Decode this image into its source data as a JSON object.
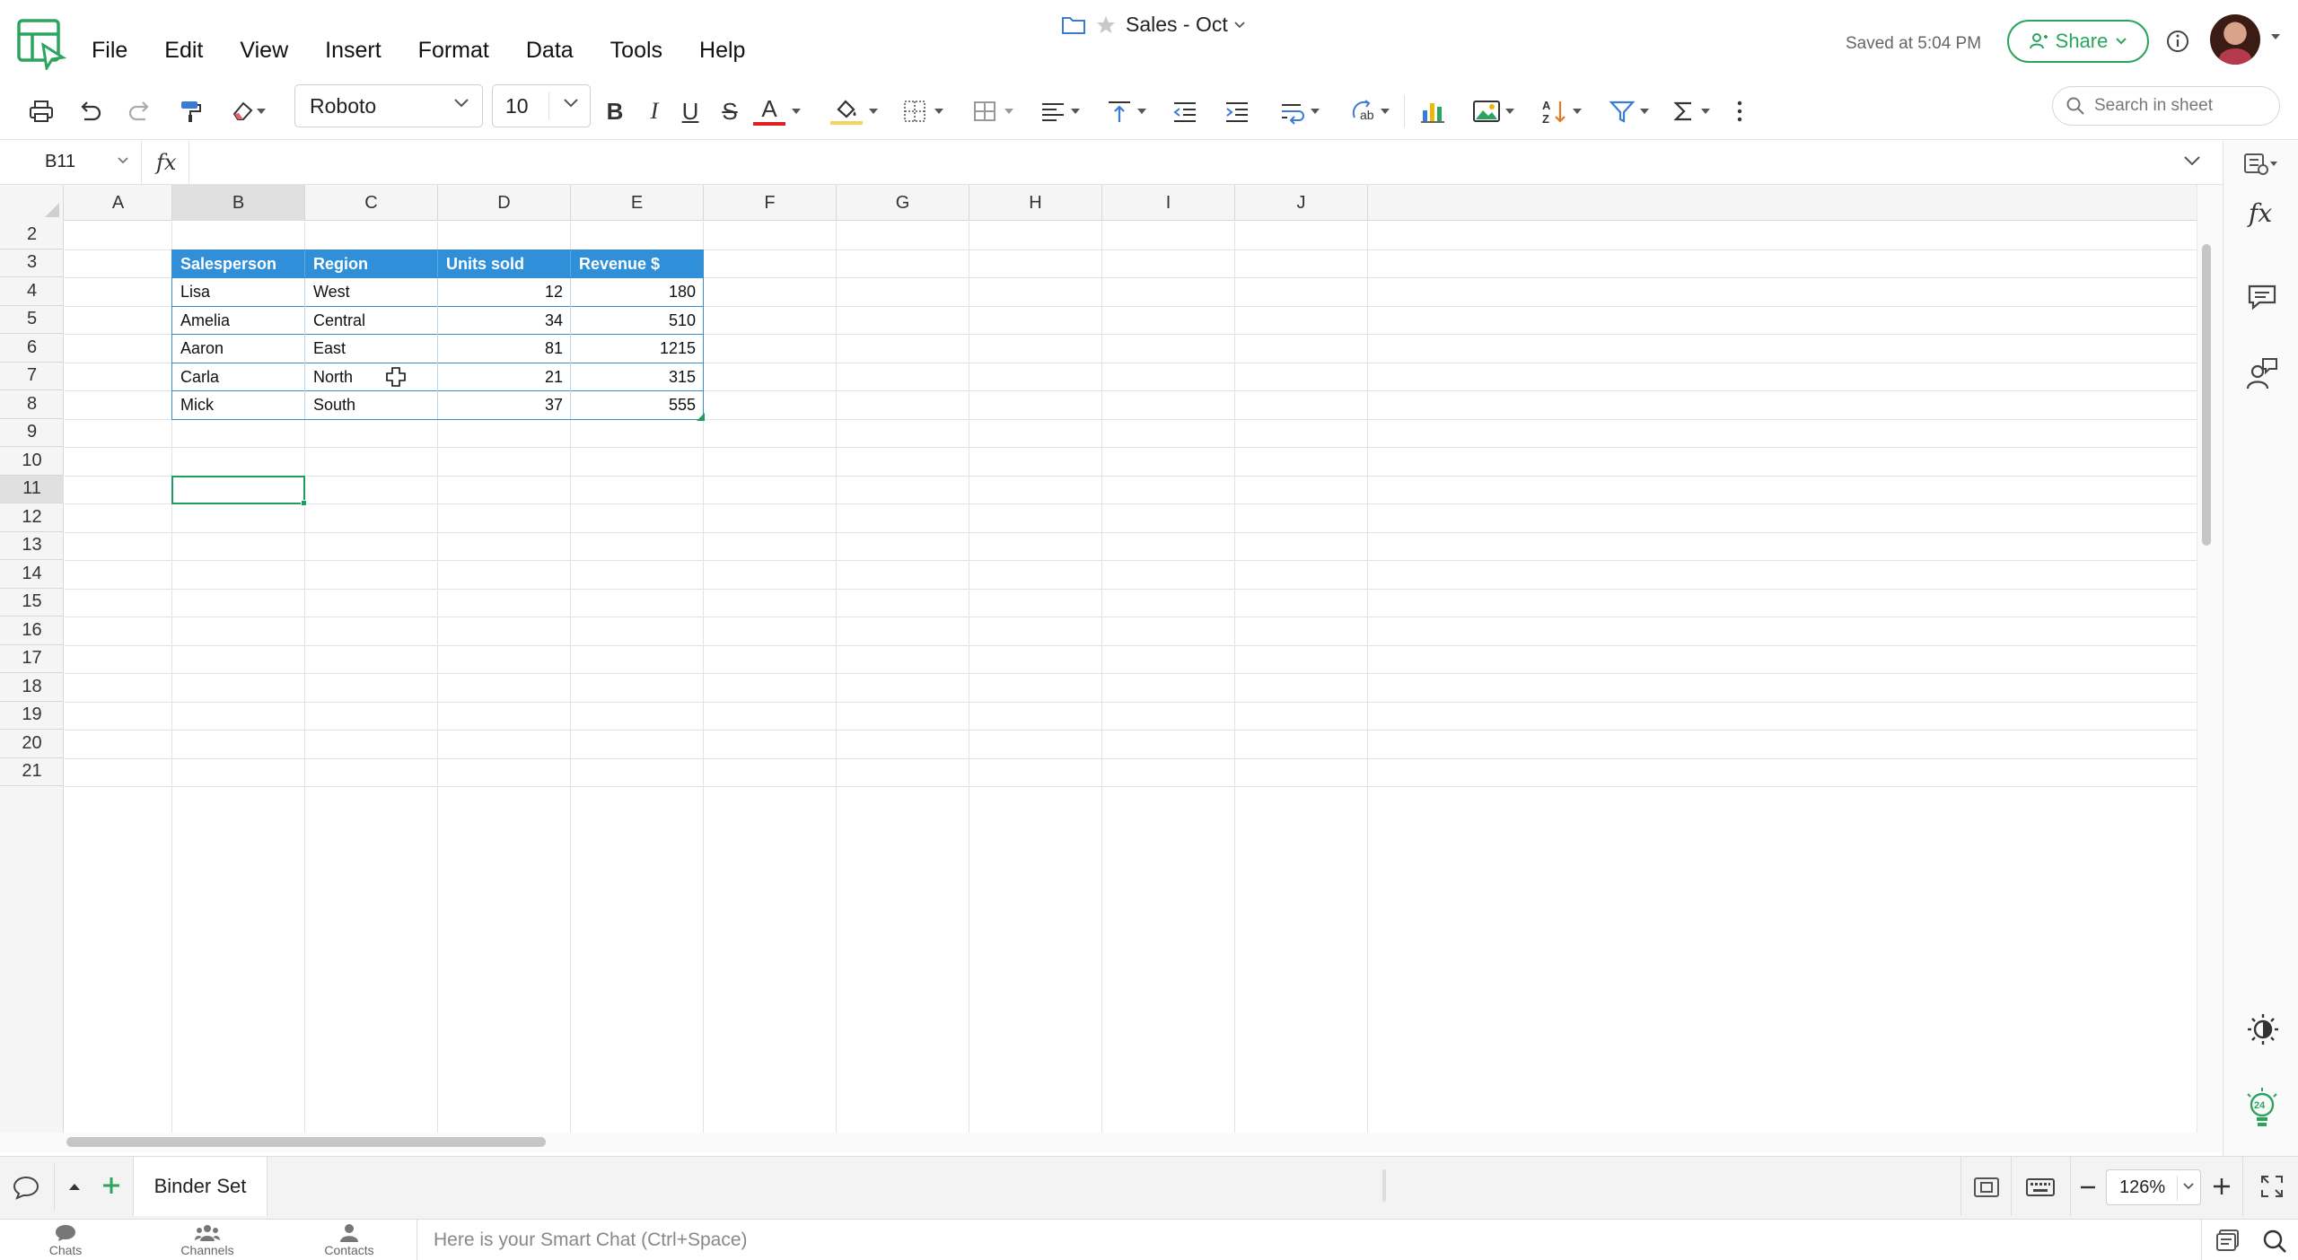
{
  "menu": [
    "File",
    "Edit",
    "View",
    "Insert",
    "Format",
    "Data",
    "Tools",
    "Help"
  ],
  "document": {
    "title": "Sales - Oct",
    "saved_status": "Saved at 5:04 PM"
  },
  "share": {
    "label": "Share"
  },
  "toolbar": {
    "font": "Roboto",
    "font_size": "10",
    "search_placeholder": "Search in sheet"
  },
  "formula_bar": {
    "cell_ref": "B11",
    "fx": "fx",
    "value": ""
  },
  "columns": [
    "A",
    "B",
    "C",
    "D",
    "E",
    "F",
    "G",
    "H",
    "I",
    "J"
  ],
  "selected_column": "B",
  "rows": [
    "2",
    "3",
    "4",
    "5",
    "6",
    "7",
    "8",
    "9",
    "10",
    "11",
    "12",
    "13",
    "14",
    "15",
    "16",
    "17",
    "18",
    "19",
    "20",
    "21"
  ],
  "selected_row": "11",
  "table": {
    "headers": [
      "Salesperson",
      "Region",
      "Units sold",
      "Revenue $"
    ],
    "rows": [
      [
        "Lisa",
        "West",
        "12",
        "180"
      ],
      [
        "Amelia",
        "Central",
        "34",
        "510"
      ],
      [
        "Aaron",
        "East",
        "81",
        "1215"
      ],
      [
        "Carla",
        "North",
        "21",
        "315"
      ],
      [
        "Mick",
        "South",
        "37",
        "555"
      ]
    ],
    "header_color": "#2f8fd8"
  },
  "selection": {
    "cell": "B11",
    "color": "#1e9e5c"
  },
  "sheets": [
    {
      "name": "Binder Set",
      "active": true
    }
  ],
  "zoom": "126%",
  "chat": {
    "nav": [
      "Chats",
      "Channels",
      "Contacts"
    ],
    "placeholder": "Here is your Smart Chat (Ctrl+Space)"
  },
  "colors": {
    "accent": "#2ba55e",
    "table_border": "#3c8bc6"
  }
}
